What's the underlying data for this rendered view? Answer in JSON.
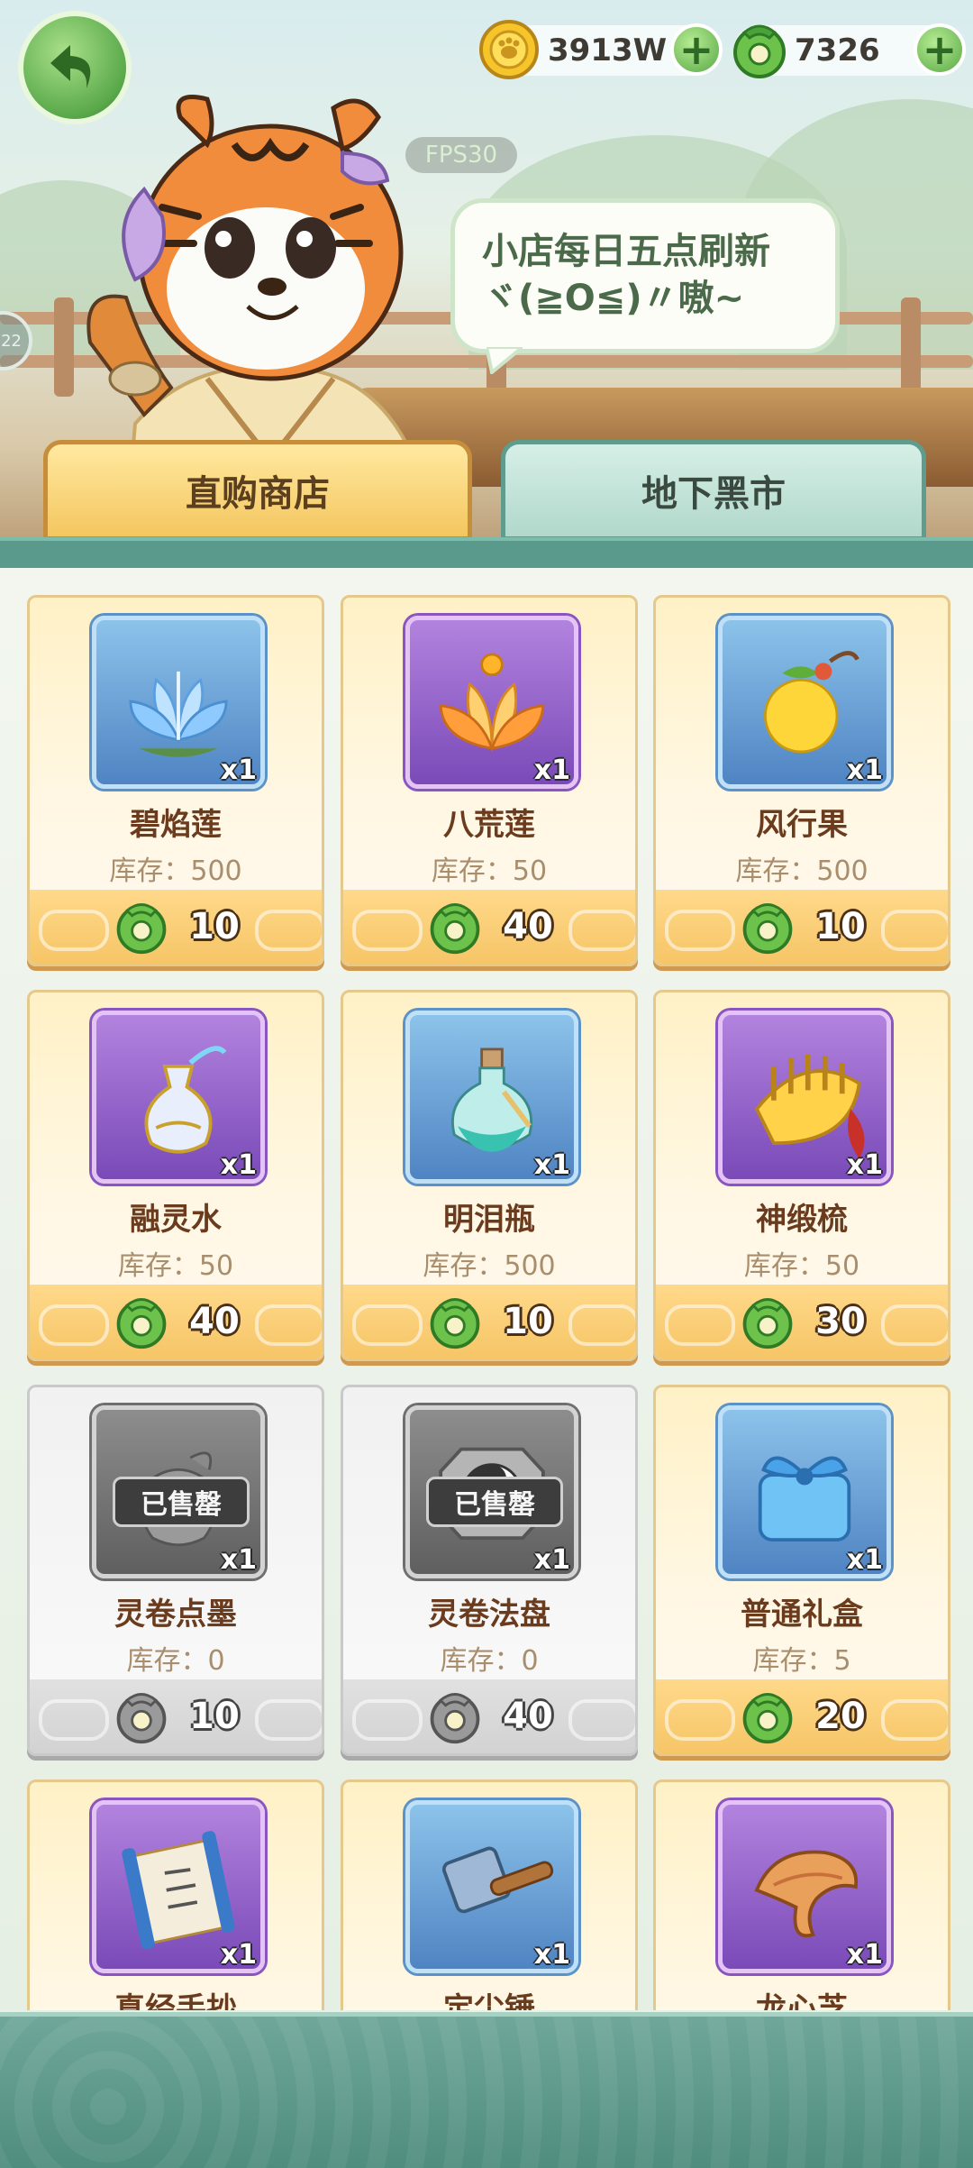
{
  "header": {
    "fps_label": "FPS30",
    "side_tab_label": "22",
    "currencies": [
      {
        "name": "gold-coin",
        "value": "3913W",
        "icon": "gold-coin-icon",
        "color": "#f1c232"
      },
      {
        "name": "jade",
        "value": "7326",
        "icon": "jade-dragon-ring-icon",
        "color": "#5fb345"
      }
    ],
    "speech_bubble": {
      "line1": "小店每日五点刷新",
      "line2": "ヾ(≧O≦)〃嗷~"
    }
  },
  "tabs": [
    {
      "label": "直购商店",
      "selected": true
    },
    {
      "label": "地下黑市",
      "selected": false
    }
  ],
  "items": [
    {
      "name": "碧焰莲",
      "stock": "库存：500",
      "price": "10",
      "qty": "x1",
      "rarity": "blue",
      "icon": "blue-lotus-icon",
      "sold_out": false
    },
    {
      "name": "八荒莲",
      "stock": "库存：50",
      "price": "40",
      "qty": "x1",
      "rarity": "purple",
      "icon": "orange-lotus-icon",
      "sold_out": false
    },
    {
      "name": "风行果",
      "stock": "库存：500",
      "price": "10",
      "qty": "x1",
      "rarity": "blue",
      "icon": "golden-fruit-icon",
      "sold_out": false
    },
    {
      "name": "融灵水",
      "stock": "库存：50",
      "price": "40",
      "qty": "x1",
      "rarity": "purple",
      "icon": "water-vase-icon",
      "sold_out": false
    },
    {
      "name": "明泪瓶",
      "stock": "库存：500",
      "price": "10",
      "qty": "x1",
      "rarity": "blue",
      "icon": "potion-bottle-icon",
      "sold_out": false
    },
    {
      "name": "神缎梳",
      "stock": "库存：50",
      "price": "30",
      "qty": "x1",
      "rarity": "purple",
      "icon": "golden-comb-icon",
      "sold_out": false
    },
    {
      "name": "灵卷点墨",
      "stock": "库存：0",
      "price": "10",
      "qty": "x1",
      "rarity": "grey",
      "icon": "ink-pot-icon",
      "sold_out": true,
      "sold_label": "已售罄"
    },
    {
      "name": "灵卷法盘",
      "stock": "库存：0",
      "price": "40",
      "qty": "x1",
      "rarity": "grey",
      "icon": "taiji-plate-icon",
      "sold_out": true,
      "sold_label": "已售罄"
    },
    {
      "name": "普通礼盒",
      "stock": "库存：5",
      "price": "20",
      "qty": "x1",
      "rarity": "blue",
      "icon": "gift-box-icon",
      "sold_out": false
    },
    {
      "name": "真经手抄",
      "stock": "",
      "price": "",
      "qty": "x1",
      "rarity": "purple",
      "icon": "scroll-icon",
      "sold_out": false
    },
    {
      "name": "定尘锤",
      "stock": "",
      "price": "",
      "qty": "x1",
      "rarity": "blue",
      "icon": "hammer-icon",
      "sold_out": false
    },
    {
      "name": "龙心芝",
      "stock": "",
      "price": "",
      "qty": "x1",
      "rarity": "purple",
      "icon": "lingzhi-mushroom-icon",
      "sold_out": false
    }
  ],
  "colors": {
    "jade_currency": "#5fb345",
    "gold_currency": "#f1c232",
    "card_border": "#e5c88c",
    "tab_active": "#f4c65f",
    "tab_inactive": "#b1d8cb"
  }
}
